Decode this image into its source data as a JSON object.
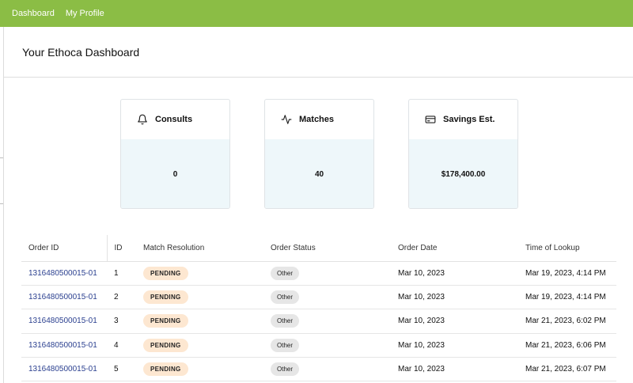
{
  "nav": {
    "items": [
      "Dashboard",
      "My Profile"
    ]
  },
  "header": {
    "title": "Your Ethoca Dashboard"
  },
  "cards": [
    {
      "title": "Consults",
      "value": "0",
      "icon": "bell-icon"
    },
    {
      "title": "Matches",
      "value": "40",
      "icon": "activity-icon"
    },
    {
      "title": "Savings Est.",
      "value": "$178,400.00",
      "icon": "credit-card-icon"
    }
  ],
  "table": {
    "columns": [
      "Order ID",
      "ID",
      "Match Resolution",
      "Order Status",
      "Order Date",
      "Time of Lookup"
    ],
    "rows": [
      {
        "order_id": "1316480500015-01",
        "id": "1",
        "resolution": "PENDING",
        "status": "Other",
        "order_date": "Mar 10, 2023",
        "lookup": "Mar 19, 2023, 4:14 PM"
      },
      {
        "order_id": "1316480500015-01",
        "id": "2",
        "resolution": "PENDING",
        "status": "Other",
        "order_date": "Mar 10, 2023",
        "lookup": "Mar 19, 2023, 4:14 PM"
      },
      {
        "order_id": "1316480500015-01",
        "id": "3",
        "resolution": "PENDING",
        "status": "Other",
        "order_date": "Mar 10, 2023",
        "lookup": "Mar 21, 2023, 6:02 PM"
      },
      {
        "order_id": "1316480500015-01",
        "id": "4",
        "resolution": "PENDING",
        "status": "Other",
        "order_date": "Mar 10, 2023",
        "lookup": "Mar 21, 2023, 6:06 PM"
      },
      {
        "order_id": "1316480500015-01",
        "id": "5",
        "resolution": "PENDING",
        "status": "Other",
        "order_date": "Mar 10, 2023",
        "lookup": "Mar 21, 2023, 6:07 PM"
      }
    ]
  },
  "colors": {
    "nav_bg": "#8bbd45",
    "card_body_bg": "#eef7fa",
    "link": "#2a3f8f",
    "pending_bg": "#fde7d1",
    "other_bg": "#e6e6e6"
  }
}
